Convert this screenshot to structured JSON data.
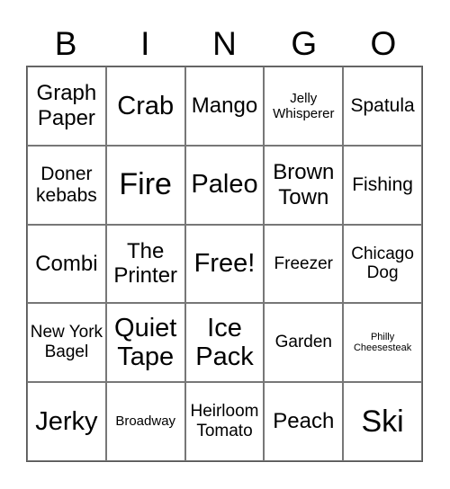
{
  "header": [
    "B",
    "I",
    "N",
    "G",
    "O"
  ],
  "cells": [
    {
      "text": "Graph Paper",
      "size": "m"
    },
    {
      "text": "Crab",
      "size": "l"
    },
    {
      "text": "Mango",
      "size": "m"
    },
    {
      "text": "Jelly Whisperer",
      "size": "xs"
    },
    {
      "text": "Spatula",
      "size": "n"
    },
    {
      "text": "Doner kebabs",
      "size": "n"
    },
    {
      "text": "Fire",
      "size": "xl"
    },
    {
      "text": "Paleo",
      "size": "l"
    },
    {
      "text": "Brown Town",
      "size": "m"
    },
    {
      "text": "Fishing",
      "size": "n"
    },
    {
      "text": "Combi",
      "size": "m"
    },
    {
      "text": "The Printer",
      "size": "m"
    },
    {
      "text": "Free!",
      "size": "l"
    },
    {
      "text": "Freezer",
      "size": "sm"
    },
    {
      "text": "Chicago Dog",
      "size": "sm"
    },
    {
      "text": "New York Bagel",
      "size": "sm"
    },
    {
      "text": "Quiet Tape",
      "size": "l"
    },
    {
      "text": "Ice Pack",
      "size": "l"
    },
    {
      "text": "Garden",
      "size": "sm"
    },
    {
      "text": "Philly Cheesesteak",
      "size": "xxs"
    },
    {
      "text": "Jerky",
      "size": "l"
    },
    {
      "text": "Broadway",
      "size": "xs"
    },
    {
      "text": "Heirloom Tomato",
      "size": "sm"
    },
    {
      "text": "Peach",
      "size": "m"
    },
    {
      "text": "Ski",
      "size": "xl"
    }
  ]
}
